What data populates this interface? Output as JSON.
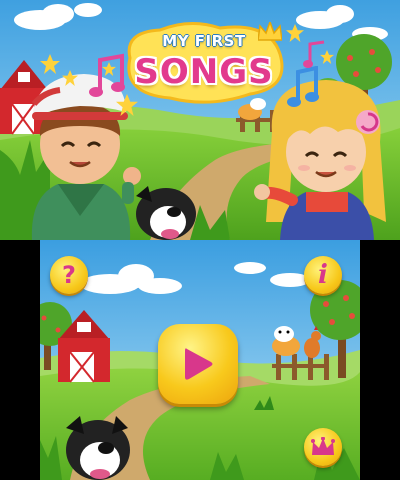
{
  "logo": {
    "line1": "MY FIRST",
    "line2": "SONGS"
  },
  "top_screen": {
    "characters": [
      "boy-in-cap",
      "girl-with-lollipop",
      "dog"
    ],
    "icons": [
      "music-note-icon",
      "star-icon",
      "crown-icon"
    ]
  },
  "bottom_screen": {
    "buttons": {
      "help": {
        "glyph": "?",
        "icon": "question-mark-icon"
      },
      "info": {
        "glyph": "i",
        "icon": "info-icon"
      },
      "play": {
        "icon": "play-triangle-icon"
      },
      "trophy": {
        "icon": "crown-icon"
      }
    }
  },
  "colors": {
    "sky": "#5fb6ea",
    "grass": "#6bbf2a",
    "path": "#c9a66b",
    "button_yellow": "#f7c81a",
    "button_pink": "#d8378b",
    "logo_pink": "#e23a8d",
    "barn_red": "#c9262a"
  }
}
